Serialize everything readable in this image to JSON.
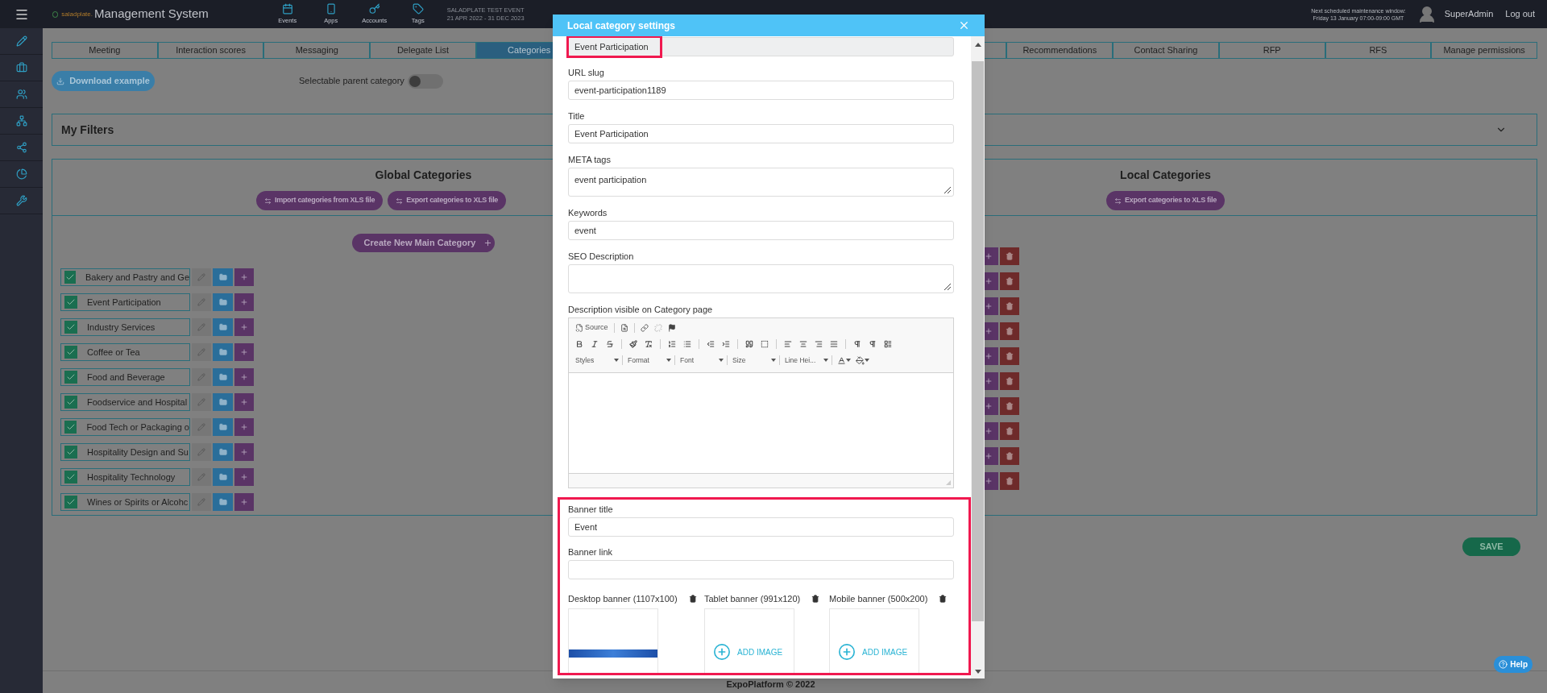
{
  "top_bar": {
    "logo_text": "saladplate.",
    "app_title": "Management System",
    "nav": [
      {
        "label": "Events"
      },
      {
        "label": "Apps"
      },
      {
        "label": "Accounts"
      },
      {
        "label": "Tags"
      }
    ],
    "event_name": "SALADPLATE TEST EVENT",
    "event_dates": "21 APR 2022 - 31 DEC 2023",
    "maintenance_title": "Next scheduled maintenance window:",
    "maintenance_time": "Friday 13 January 07:00-09:00 GMT",
    "user": "SuperAdmin",
    "logout": "Log out"
  },
  "tabs": {
    "left": [
      {
        "label": "Meeting",
        "selected": false
      },
      {
        "label": "Interaction scores",
        "selected": false
      },
      {
        "label": "Messaging",
        "selected": false
      },
      {
        "label": "Delegate List",
        "selected": false
      },
      {
        "label": "Categories",
        "selected": true
      }
    ],
    "right": [
      {
        "label": "Recommendations",
        "selected": false
      },
      {
        "label": "Contact Sharing",
        "selected": false
      },
      {
        "label": "RFP",
        "selected": false
      },
      {
        "label": "RFS",
        "selected": false
      },
      {
        "label": "Manage permissions",
        "selected": false
      }
    ]
  },
  "download_button": "Download example",
  "parent_toggle": {
    "label": "Selectable parent category",
    "on": false
  },
  "filters": {
    "title": "My Filters",
    "expanded": false
  },
  "global": {
    "title": "Global Categories",
    "buttons": [
      "Import categories from XLS file",
      "Export categories to XLS file"
    ],
    "create_button": "Create New Main Category",
    "rows": [
      {
        "name": "Bakery and Pastry and Ge",
        "checked": true
      },
      {
        "name": "Event Participation",
        "checked": true
      },
      {
        "name": "Industry Services",
        "checked": true
      },
      {
        "name": "Coffee or Tea",
        "checked": true
      },
      {
        "name": "Food and Beverage",
        "checked": true
      },
      {
        "name": "Foodservice and Hospital",
        "checked": true
      },
      {
        "name": "Food Tech or Packaging o",
        "checked": true
      },
      {
        "name": "Hospitality Design and Su",
        "checked": true
      },
      {
        "name": "Hospitality Technology",
        "checked": true
      },
      {
        "name": "Wines or Spirits or Alcohc",
        "checked": true
      }
    ]
  },
  "local": {
    "title": "Local Categories",
    "buttons": [
      "Export categories to XLS file"
    ]
  },
  "save_button": "SAVE",
  "help_button": "Help",
  "footer": "ExpoPlatform © 2022",
  "modal": {
    "title": "Local category settings",
    "name_value": "Event Participation",
    "fields": [
      {
        "label": "URL slug",
        "value": "event-participation1189",
        "kind": "input"
      },
      {
        "label": "Title",
        "value": "Event Participation",
        "kind": "input"
      },
      {
        "label": "META tags",
        "value": "event participation",
        "kind": "textarea"
      },
      {
        "label": "Keywords",
        "value": "event",
        "kind": "input"
      },
      {
        "label": "SEO Description",
        "kind": "textarea"
      }
    ],
    "editor": {
      "label": "Description visible on Category page",
      "source_label": "Source",
      "combos": [
        "Styles",
        "Format",
        "Font",
        "Size",
        "Line Hei..."
      ]
    },
    "banner_fields": [
      {
        "label": "Banner title",
        "value": "Event"
      },
      {
        "label": "Banner link"
      }
    ],
    "banners": [
      {
        "label": "Desktop banner (1107x100)",
        "kind": "image"
      },
      {
        "label": "Tablet banner (991x120)",
        "kind": "empty",
        "add_label": "ADD IMAGE"
      },
      {
        "label": "Mobile banner (500x200)",
        "kind": "empty",
        "add_label": "ADD IMAGE"
      }
    ]
  }
}
